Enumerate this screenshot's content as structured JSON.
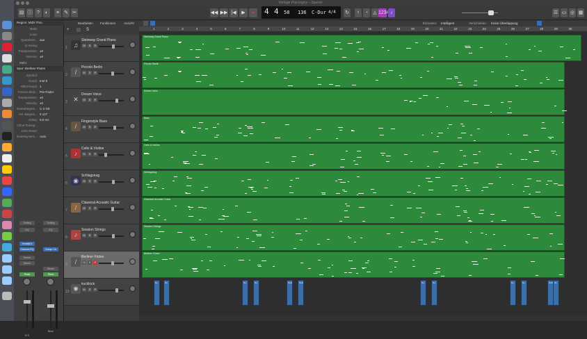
{
  "window": {
    "title": "Vorlage Pop.logicx – Spuren"
  },
  "lcd": {
    "bar": "4",
    "beat": "4",
    "tempo": "58",
    "bpm": "136",
    "key": "C-Dur",
    "sig": "4/4"
  },
  "toolbar": {
    "edit": "Bearbeiten",
    "functions": "Funktionen",
    "view": "Ansicht",
    "snap_label": "Einrasten:",
    "snap_value": "Intelligent",
    "drag_label": "Verschieben:",
    "drag_value": "Keine Überlappung",
    "badge": "1234"
  },
  "inspector": {
    "region_header": "Region: MIDI Thru",
    "region_rows": [
      {
        "label": "Mute:",
        "value": ""
      },
      {
        "label": "Loop:",
        "value": ""
      },
      {
        "label": "Quantisier...",
        "value": "aus"
      },
      {
        "label": "Q-Swing:",
        "value": ""
      },
      {
        "label": "Transposition:",
        "value": "±0"
      },
      {
        "label": "Velocity:",
        "value": "±0"
      }
    ],
    "more": "Mehr",
    "track_header": "Spur: Berliner Flutes",
    "track_rows": [
      {
        "label": "Symbol:",
        "value": ""
      },
      {
        "label": "Kanal:",
        "value": "Inst 9"
      },
      {
        "label": "MIDI-Kanal:",
        "value": "1"
      },
      {
        "label": "Freeze-Mod...",
        "value": "Pre-Fader"
      },
      {
        "label": "Transposition:",
        "value": "±0"
      },
      {
        "label": "Velocity:",
        "value": "±0"
      },
      {
        "label": "Notenbegren...",
        "value": "C-2  G8"
      },
      {
        "label": "Vel.-Begren...",
        "value": "0  127"
      },
      {
        "label": "Delay:",
        "value": "0,0 ms"
      },
      {
        "label": "Ohne Transp...",
        "value": ""
      },
      {
        "label": "Kein Reset:",
        "value": ""
      },
      {
        "label": "Notensystem...",
        "value": "Auto"
      }
    ],
    "strip1": {
      "setting": "Setting",
      "eq": "EQ",
      "plugin": "Kontakt 5",
      "chanEQ": "Channel EQ",
      "sends": "Sends",
      "stereo": "Stereo",
      "read": "Read",
      "name": "M S"
    },
    "strip2": {
      "setting": "Setting",
      "eq": "EQ",
      "plugin": "Compr Co",
      "stereo": "Stereo",
      "read": "Read",
      "name": "Bnce"
    }
  },
  "tracks": [
    {
      "num": "1",
      "name": "Steinway Grand Piano",
      "icon": "piano-icon",
      "fader": 0.6
    },
    {
      "num": "2",
      "name": "Piccolo Berlin",
      "icon": "flute-icon",
      "fader": 0.55
    },
    {
      "num": "3",
      "name": "Dream Voice",
      "icon": "voice-icon",
      "fader": 0.75
    },
    {
      "num": "4",
      "name": "Fingerstyle Bass",
      "icon": "bass-guitar-icon",
      "fader": 0.65
    },
    {
      "num": "5",
      "name": "Cello & Violine",
      "icon": "strings-icon",
      "fader": 0.25
    },
    {
      "num": "6",
      "name": "Schlagzeug",
      "icon": "drum-kit-icon",
      "fader": 0.6
    },
    {
      "num": "7",
      "name": "Classical Acoustic Guitar",
      "icon": "acoustic-guitar-icon",
      "fader": 0.55
    },
    {
      "num": "8",
      "name": "Session Strings",
      "icon": "strings-icon",
      "fader": 0.6
    },
    {
      "num": "9",
      "name": "Berliner Flutes",
      "icon": "flute-icon",
      "fader": 0.55
    },
    {
      "num": "10",
      "name": "kucklock",
      "icon": "sampler-icon",
      "fader": 0.75
    }
  ],
  "regions": [
    {
      "name": "Steinway Grand Piano"
    },
    {
      "name": "Piccolo Berlin"
    },
    {
      "name": "Dream Voice"
    },
    {
      "name": "Bass"
    },
    {
      "name": "Cello & Violine"
    },
    {
      "name": "Schlagzeug"
    },
    {
      "name": "Classical Acoustic Guitar"
    },
    {
      "name": "Session Strings"
    },
    {
      "name": "Berliner Flutes"
    }
  ],
  "drum_regions": [
    {
      "label": "Su"
    },
    {
      "label": "Su"
    },
    {
      "label": "Su"
    },
    {
      "label": "Su"
    },
    {
      "label": "Sust"
    },
    {
      "label": "Sust"
    },
    {
      "label": "Su"
    },
    {
      "label": "Su"
    },
    {
      "label": "Su"
    },
    {
      "label": "Su"
    },
    {
      "label": "Sust"
    },
    {
      "label": "Su"
    }
  ],
  "ruler": [
    "1",
    "2",
    "3",
    "4",
    "5",
    "6",
    "7",
    "8",
    "9",
    "10",
    "11",
    "12",
    "13",
    "14",
    "15",
    "16",
    "17",
    "18",
    "19",
    "20",
    "21",
    "22",
    "23",
    "24",
    "25",
    "26",
    "27",
    "28",
    "29",
    "30"
  ]
}
